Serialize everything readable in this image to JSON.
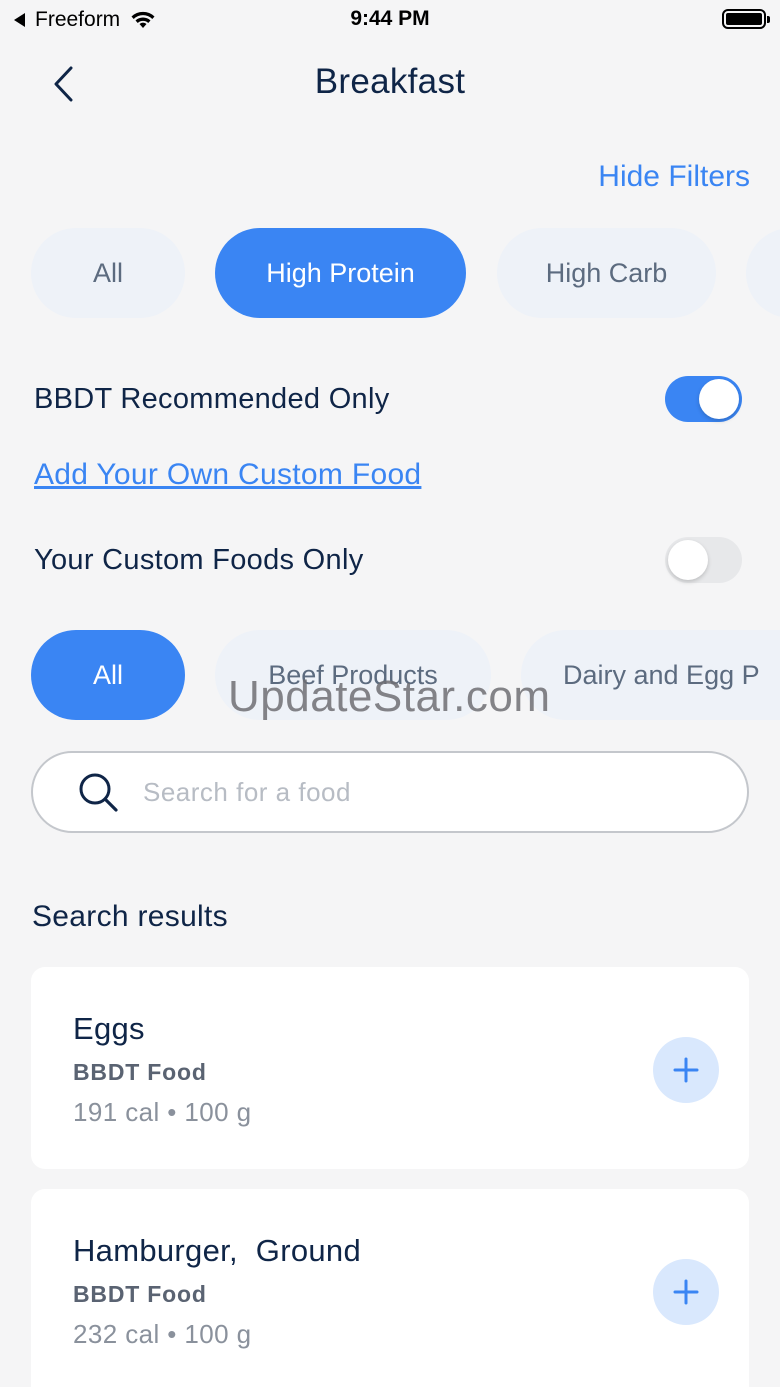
{
  "status_bar": {
    "back_app": "Freeform",
    "time": "9:44 PM",
    "icons": [
      "back-triangle-icon",
      "wifi-icon",
      "battery-icon"
    ]
  },
  "header": {
    "title": "Breakfast",
    "back_icon": "chevron-left-icon",
    "hide_filters": "Hide Filters"
  },
  "macro_filters": [
    {
      "label": "All",
      "active": false
    },
    {
      "label": "High Protein",
      "active": true
    },
    {
      "label": "High Carb",
      "active": false
    }
  ],
  "toggles": {
    "recommended": {
      "label": "BBDT Recommended Only",
      "on": true
    },
    "custom_only": {
      "label": "Your Custom Foods Only",
      "on": false
    }
  },
  "custom_food_link": "Add Your Own Custom Food",
  "category_filters": [
    {
      "label": "All",
      "active": true
    },
    {
      "label": "Beef Products",
      "active": false
    },
    {
      "label": "Dairy and Egg P",
      "active": false
    }
  ],
  "search": {
    "placeholder": "Search for a food",
    "value": "",
    "icon": "search-icon"
  },
  "results": {
    "title": "Search results",
    "items": [
      {
        "name": "Eggs",
        "source": "BBDT Food",
        "meta": "191 cal • 100 g"
      },
      {
        "name": "Hamburger,  Ground",
        "source": "BBDT Food",
        "meta": "232 cal • 100 g"
      }
    ]
  },
  "watermark": "UpdateStar.com",
  "colors": {
    "accent": "#3a85f3",
    "text_primary": "#0f2547",
    "background": "#f5f5f6",
    "pill_inactive": "#eef2f8",
    "add_button_bg": "#d9e8fd"
  }
}
